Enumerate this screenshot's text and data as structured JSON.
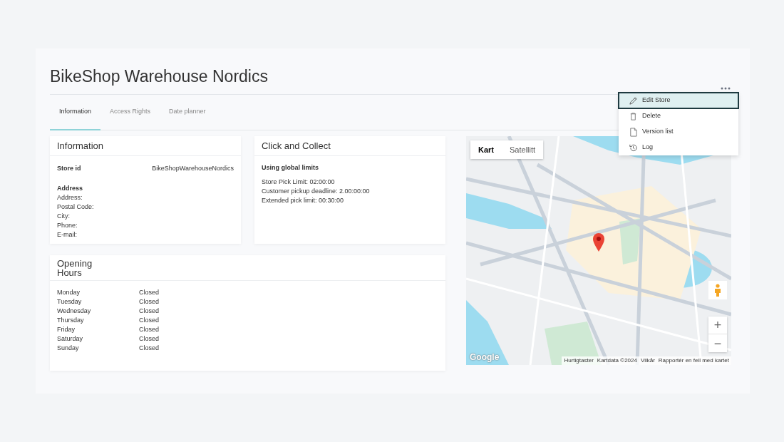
{
  "page": {
    "title": "BikeShop Warehouse Nordics"
  },
  "tabs": [
    {
      "label": "Information",
      "selected": true
    },
    {
      "label": "Access Rights",
      "selected": false
    },
    {
      "label": "Date planner",
      "selected": false
    }
  ],
  "menu": {
    "items": [
      {
        "label": "Edit Store",
        "kind": "edit",
        "selected": true
      },
      {
        "label": "Delete",
        "kind": "delete",
        "selected": false
      },
      {
        "label": "Version list",
        "kind": "versions",
        "selected": false
      },
      {
        "label": "Log",
        "kind": "log",
        "selected": false
      }
    ]
  },
  "information": {
    "title": "Information",
    "store_id_label": "Store id",
    "store_id": "BikeShopWarehouseNordics",
    "address_heading": "Address",
    "fields": [
      "Address:",
      "Postal Code:",
      "City:",
      "Phone:",
      "E-mail:"
    ]
  },
  "click_and_collect": {
    "title": "Click and Collect",
    "subtitle": "Using global limits",
    "lines": [
      "Store Pick Limit: 02:00:00",
      "Customer pickup deadline: 2.00:00:00",
      "Extended pick limit: 00:30:00"
    ]
  },
  "opening_hours": {
    "title": "Opening Hours",
    "rows": [
      {
        "day": "Monday",
        "hours": "Closed"
      },
      {
        "day": "Tuesday",
        "hours": "Closed"
      },
      {
        "day": "Wednesday",
        "hours": "Closed"
      },
      {
        "day": "Thursday",
        "hours": "Closed"
      },
      {
        "day": "Friday",
        "hours": "Closed"
      },
      {
        "day": "Saturday",
        "hours": "Closed"
      },
      {
        "day": "Sunday",
        "hours": "Closed"
      }
    ]
  },
  "map": {
    "kind": "picture",
    "map_types": [
      {
        "label": "Kart",
        "selected": true
      },
      {
        "label": "Satellitt",
        "selected": false
      }
    ],
    "zoom_in": "+",
    "zoom_out": "−",
    "logo": "Google",
    "attribution": [
      "Hurtigtaster",
      "Kartdata ©2024",
      "Vilkår",
      "Rapportér en feil med kartet"
    ]
  }
}
